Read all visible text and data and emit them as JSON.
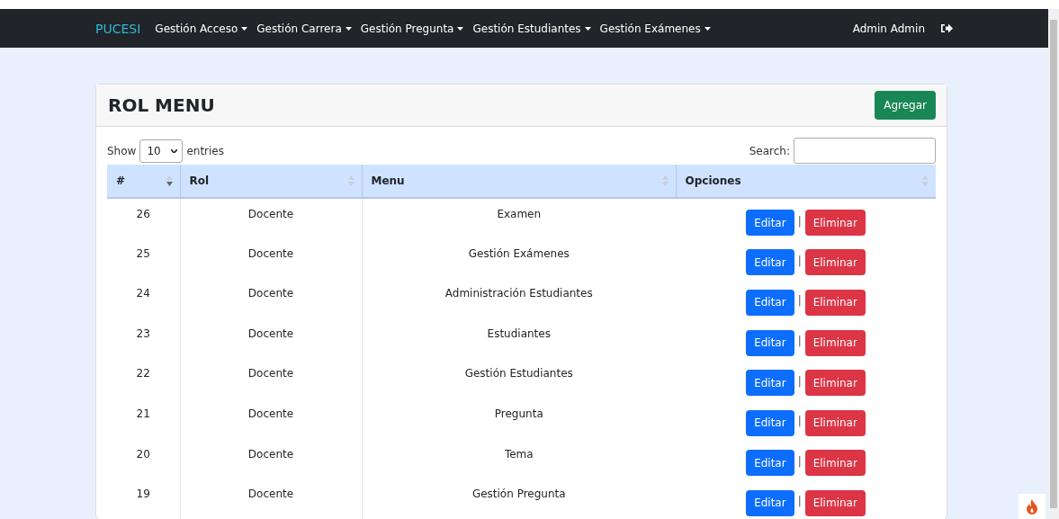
{
  "navbar": {
    "brand": "PUCESI",
    "menus": [
      "Gestión Acceso",
      "Gestión Carrera",
      "Gestión Pregunta",
      "Gestión Estudiantes",
      "Gestión Exámenes"
    ],
    "user": "Admin Admin"
  },
  "card": {
    "title": "ROL MENU",
    "add_button": "Agregar"
  },
  "table_controls": {
    "show_label": "Show",
    "page_size": "10",
    "entries_label": "entries",
    "search_label": "Search:"
  },
  "table": {
    "columns": [
      {
        "label": "#",
        "sorted": true
      },
      {
        "label": "Rol",
        "sorted": false
      },
      {
        "label": "Menu",
        "sorted": false
      },
      {
        "label": "Opciones",
        "sorted": false
      }
    ],
    "rows": [
      {
        "id": "26",
        "rol": "Docente",
        "menu": "Examen",
        "edit": "Editar",
        "separator": "|",
        "delete": "Eliminar"
      },
      {
        "id": "25",
        "rol": "Docente",
        "menu": "Gestión Exámenes",
        "edit": "Editar",
        "separator": "|",
        "delete": "Eliminar"
      },
      {
        "id": "24",
        "rol": "Docente",
        "menu": "Administración Estudiantes",
        "edit": "Editar",
        "separator": "|",
        "delete": "Eliminar"
      },
      {
        "id": "23",
        "rol": "Docente",
        "menu": "Estudiantes",
        "edit": "Editar",
        "separator": "|",
        "delete": "Eliminar"
      },
      {
        "id": "22",
        "rol": "Docente",
        "menu": "Gestión Estudiantes",
        "edit": "Editar",
        "separator": "|",
        "delete": "Eliminar"
      },
      {
        "id": "21",
        "rol": "Docente",
        "menu": "Pregunta",
        "edit": "Editar",
        "separator": "|",
        "delete": "Eliminar"
      },
      {
        "id": "20",
        "rol": "Docente",
        "menu": "Tema",
        "edit": "Editar",
        "separator": "|",
        "delete": "Eliminar"
      },
      {
        "id": "19",
        "rol": "Docente",
        "menu": "Gestión Pregunta",
        "edit": "Editar",
        "separator": "|",
        "delete": "Eliminar"
      }
    ]
  }
}
